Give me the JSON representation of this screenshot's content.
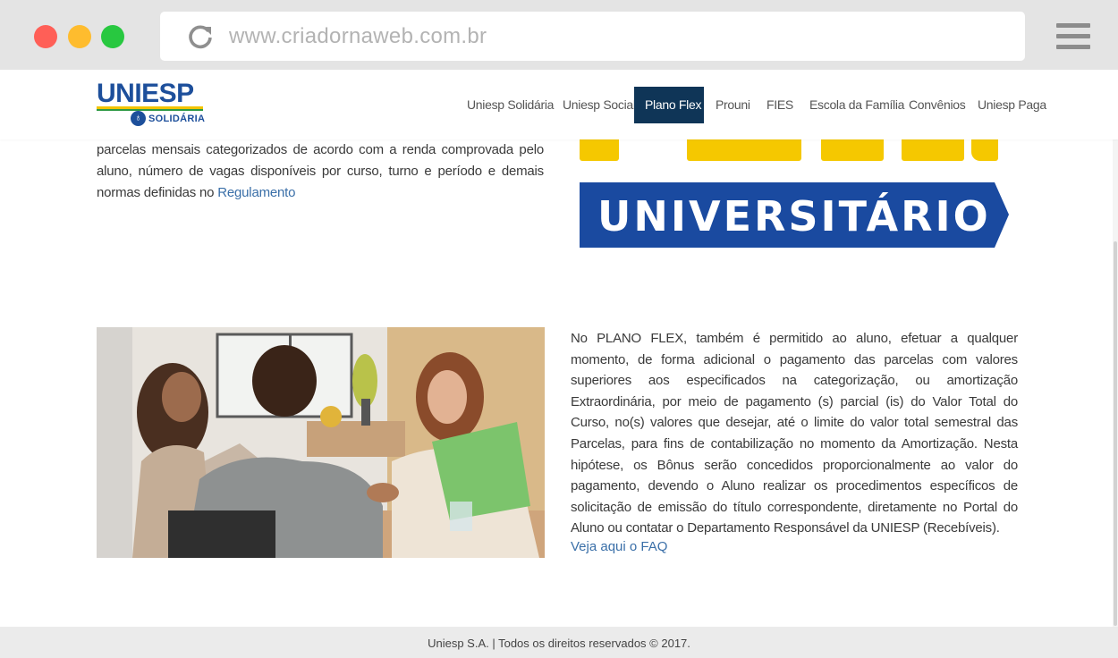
{
  "browser": {
    "url": "www.criadornaweb.com.br"
  },
  "logo": {
    "name": "UNIESP",
    "subtitle": "SOLIDÁRIA"
  },
  "nav": {
    "items": [
      {
        "label": "Uniesp Solidária"
      },
      {
        "label": "Uniesp Social"
      },
      {
        "label": "Plano Flex"
      },
      {
        "label": "Prouni"
      },
      {
        "label": "FIES"
      },
      {
        "label": "Escola da Família"
      },
      {
        "label": "Convênios"
      },
      {
        "label": "Uniesp Paga"
      }
    ],
    "active_index": 2,
    "active_color": "#0f3557"
  },
  "section1": {
    "text": "parcelas mensais categorizados de acordo com a renda comprovada pelo aluno, número de vagas disponíveis por curso, turno e período e demais normas definidas no",
    "link": "Regulamento"
  },
  "banner": {
    "text": "UNIVERSITÁRIO",
    "band_color": "#1a4aa0",
    "accent_color": "#f5c800"
  },
  "section2": {
    "text": "No PLANO FLEX, também é permitido ao aluno, efetuar a qualquer momento, de forma adicional o pagamento das parcelas com valores superiores aos especificados na categorização, ou amortização Extraordinária, por meio de pagamento (s) parcial (is) do Valor Total do Curso, no(s) valores que desejar, até o limite do valor total semestral das Parcelas, para fins de contabilização no momento da Amortização. Nesta hipótese, os Bônus serão concedidos proporcionalmente ao valor do pagamento, devendo o Aluno realizar os procedimentos específicos de solicitação de emissão do título correspondente, diretamente no Portal do Aluno ou contatar o Departamento Responsável da UNIESP (Recebíveis).",
    "faq_link": "Veja aqui o FAQ"
  },
  "footer": {
    "text": "Uniesp S.A. | Todos os direitos reservados © 2017."
  }
}
